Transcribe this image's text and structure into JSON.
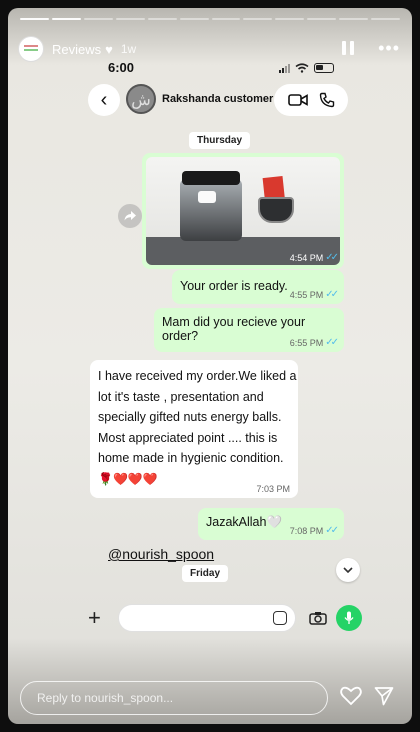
{
  "story": {
    "title": "Reviews",
    "time": "1w",
    "segments": 12,
    "reply_placeholder": "Reply to nourish_spoon..."
  },
  "phone": {
    "time": "6:00"
  },
  "chat": {
    "contact_name": "Rakshanda customer",
    "avatar_glyph": "ش",
    "date_thursday": "Thursday",
    "date_friday": "Friday",
    "photo_time": "4:54 PM",
    "messages": [
      {
        "text": "Your order is ready.",
        "time": "4:55 PM",
        "direction": "out"
      },
      {
        "text": "Mam did you recieve your order?",
        "time": "6:55 PM",
        "direction": "out"
      },
      {
        "text": "I have received my order.We liked a lot it's taste , presentation and specially gifted nuts energy balls. Most appreciated point .... this is home made in hygienic condition.",
        "emojis": "🌹❤️❤️❤️",
        "time": "7:03 PM",
        "direction": "in"
      },
      {
        "text": "JazakAllah🤍",
        "time": "7:08 PM",
        "direction": "out"
      }
    ],
    "mention": "@nourish_spoon"
  },
  "colors": {
    "outgoing_bubble": "#d9fdd3",
    "incoming_bubble": "#ffffff",
    "read_ticks": "#53bdeb",
    "mic_green": "#25d366"
  },
  "icons": [
    "heart-icon",
    "pause-icon",
    "more-icon",
    "back-icon",
    "video-call-icon",
    "phone-icon",
    "share-icon",
    "chevron-down-icon",
    "plus-icon",
    "sticker-icon",
    "camera-icon",
    "mic-icon",
    "send-icon"
  ]
}
